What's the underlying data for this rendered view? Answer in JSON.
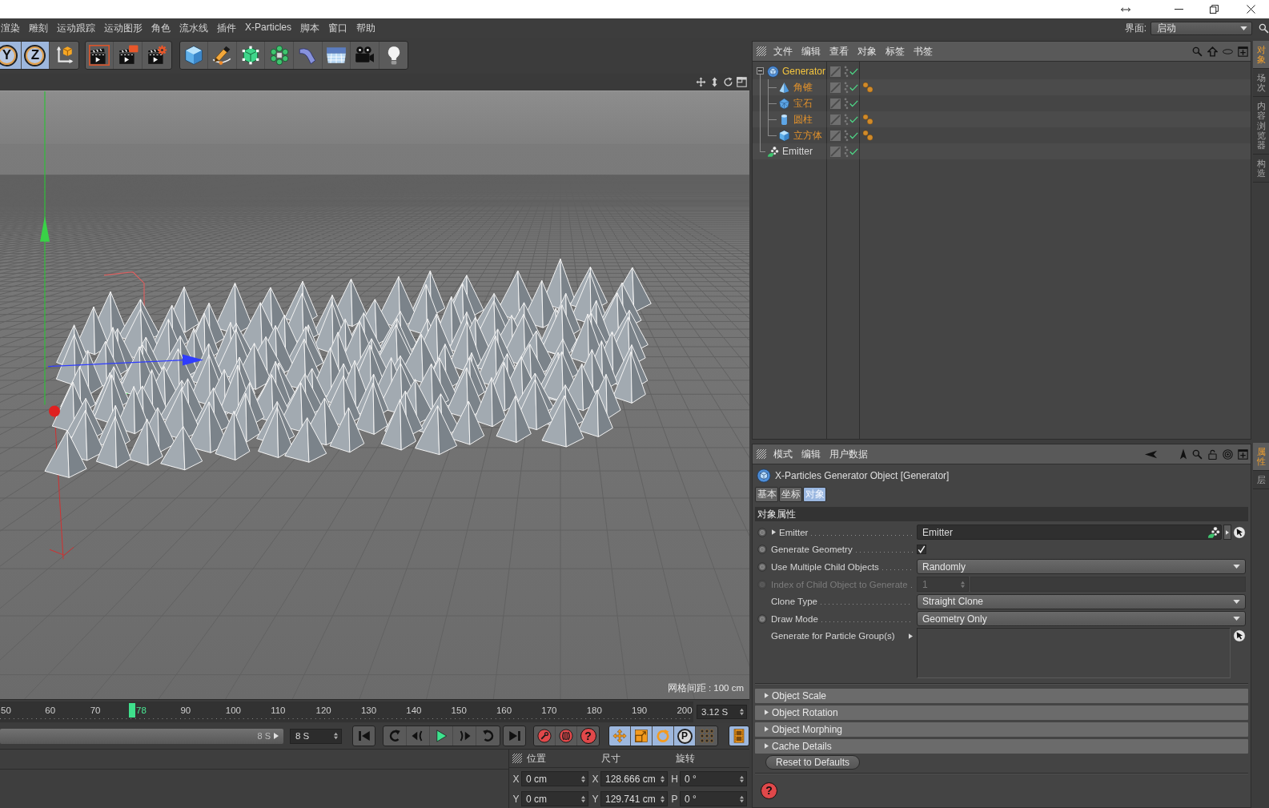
{
  "menu_bar": {
    "items": [
      "渲染",
      "雕刻",
      "运动跟踪",
      "运动图形",
      "角色",
      "流水线",
      "插件",
      "X-Particles",
      "脚本",
      "窗口",
      "帮助"
    ],
    "layout": {
      "label": "界面:",
      "value": "启动"
    }
  },
  "toolbar": {
    "groups": [
      {
        "buttons": [
          {
            "kind": "axis",
            "label": "Y",
            "selected": true
          },
          {
            "kind": "axis",
            "label": "Z",
            "selected": true
          },
          {
            "kind": "coordinate-system",
            "selected": false
          }
        ]
      },
      {
        "buttons": [
          {
            "kind": "render-view",
            "selected": false
          },
          {
            "kind": "render-picture-viewer",
            "selected": false
          },
          {
            "kind": "render-settings",
            "selected": false
          }
        ]
      },
      {
        "buttons": [
          {
            "kind": "cube",
            "selected": false
          },
          {
            "kind": "pen",
            "selected": false
          },
          {
            "kind": "subdivision",
            "selected": false
          },
          {
            "kind": "cloner",
            "selected": false
          },
          {
            "kind": "deformer",
            "selected": false
          },
          {
            "kind": "floor",
            "selected": false
          },
          {
            "kind": "camera",
            "selected": false
          },
          {
            "kind": "light",
            "selected": false
          }
        ]
      }
    ]
  },
  "viewport": {
    "grid_spacing": "网格间距 : 100 cm"
  },
  "timeline": {
    "marks": [
      {
        "kind": "tick",
        "label": "50"
      },
      {
        "kind": "tick",
        "label": "60"
      },
      {
        "kind": "tick",
        "label": "70"
      },
      {
        "kind": "playhead",
        "label": "78"
      },
      {
        "kind": "tick",
        "label": "90"
      },
      {
        "kind": "tick",
        "label": "100"
      },
      {
        "kind": "tick",
        "label": "110"
      },
      {
        "kind": "tick",
        "label": "120"
      },
      {
        "kind": "tick",
        "label": "130"
      },
      {
        "kind": "tick",
        "label": "140"
      },
      {
        "kind": "tick",
        "label": "150"
      },
      {
        "kind": "tick",
        "label": "160"
      },
      {
        "kind": "tick",
        "label": "170"
      },
      {
        "kind": "tick",
        "label": "180"
      },
      {
        "kind": "tick",
        "label": "190"
      },
      {
        "kind": "tick",
        "label": "200"
      }
    ],
    "current_time": "3.12 S"
  },
  "playback": {
    "range": {
      "label": "8 S",
      "level": 1
    },
    "end_time": "8 S",
    "groups": [
      {
        "buttons": [
          {
            "kind": "go-start",
            "selected": false
          }
        ]
      },
      {
        "buttons": [
          {
            "kind": "loop-back",
            "selected": false
          },
          {
            "kind": "step-back",
            "selected": false
          },
          {
            "kind": "play",
            "selected": false
          },
          {
            "kind": "step-forward",
            "selected": false
          },
          {
            "kind": "loop-forward",
            "selected": false
          }
        ]
      },
      {
        "buttons": [
          {
            "kind": "go-end",
            "selected": false
          }
        ]
      },
      {
        "buttons": [
          {
            "kind": "record",
            "selected": false
          },
          {
            "kind": "auto-key",
            "selected": false
          },
          {
            "kind": "key-help",
            "label": "?",
            "selected": false
          }
        ]
      },
      {
        "buttons": [
          {
            "kind": "move",
            "selected": true
          },
          {
            "kind": "scale",
            "selected": true
          },
          {
            "kind": "rotate",
            "selected": true
          },
          {
            "kind": "param",
            "label": "P",
            "selected": true
          },
          {
            "kind": "dots",
            "selected": false
          }
        ]
      },
      {
        "buttons": [
          {
            "kind": "film",
            "selected": true
          }
        ]
      }
    ]
  },
  "coordinates": {
    "headers": [
      "位置",
      "尺寸",
      "旋转"
    ],
    "rows": [
      [
        {
          "axis": "X",
          "value": "0 cm"
        },
        {
          "axis": "X",
          "value": "128.666 cm"
        },
        {
          "axis": "H",
          "value": "0 °"
        }
      ],
      [
        {
          "axis": "Y",
          "value": "0 cm"
        },
        {
          "axis": "Y",
          "value": "129.741 cm"
        },
        {
          "axis": "P",
          "value": "0 °"
        }
      ]
    ]
  },
  "object_manager": {
    "menu": [
      "文件",
      "编辑",
      "查看",
      "对象",
      "标签",
      "书签"
    ],
    "objects": [
      {
        "name": "Generator",
        "kind": "generator",
        "selected": true,
        "expanded": true,
        "enabled": true,
        "children": [
          {
            "name": "角锥",
            "kind": "pyramid",
            "selected": false,
            "highlighted": true,
            "enabled": true,
            "tags": [
              {
                "kind": "spheres"
              }
            ]
          },
          {
            "name": "宝石",
            "kind": "gem",
            "selected": false,
            "highlighted": true,
            "enabled": true
          },
          {
            "name": "圆柱",
            "kind": "cylinder",
            "selected": false,
            "highlighted": true,
            "enabled": true,
            "tags": [
              {
                "kind": "spheres"
              }
            ]
          },
          {
            "name": "立方体",
            "kind": "cube",
            "selected": false,
            "highlighted": true,
            "enabled": true,
            "tags": [
              {
                "kind": "spheres"
              }
            ]
          }
        ]
      },
      {
        "name": "Emitter",
        "kind": "emitter",
        "selected": false,
        "enabled": true
      }
    ]
  },
  "attribute_manager": {
    "menu": [
      "模式",
      "编辑",
      "用户数据"
    ],
    "object": {
      "kind": "generator",
      "title": "X-Particles Generator Object [Generator]"
    },
    "tabs": [
      {
        "label": "基本",
        "selected": false
      },
      {
        "label": "坐标",
        "selected": false
      },
      {
        "label": "对象",
        "selected": true
      }
    ],
    "section": "对象属性",
    "params": [
      {
        "kind": "link",
        "label": "Emitter",
        "animatable": true,
        "disabled": false,
        "target": {
          "kind": "emitter",
          "name": "Emitter"
        }
      },
      {
        "kind": "checkbox",
        "label": "Generate Geometry",
        "animatable": true,
        "disabled": false,
        "checked": true
      },
      {
        "kind": "dropdown",
        "label": "Use Multiple Child Objects",
        "animatable": true,
        "disabled": false,
        "value": "Randomly"
      },
      {
        "kind": "number",
        "label": "Index of Child Object to Generate",
        "animatable": true,
        "disabled": true,
        "value": "1"
      },
      {
        "kind": "dropdown",
        "label": "Clone Type",
        "animatable": false,
        "disabled": false,
        "value": "Straight Clone"
      },
      {
        "kind": "dropdown",
        "label": "Draw Mode",
        "animatable": true,
        "disabled": false,
        "value": "Geometry Only"
      },
      {
        "kind": "list",
        "label": "Generate for Particle Group(s)",
        "animatable": false,
        "disabled": false
      }
    ],
    "groups": [
      {
        "label": "Object Scale",
        "expanded": false
      },
      {
        "label": "Object Rotation",
        "expanded": false
      },
      {
        "label": "Object Morphing",
        "expanded": false
      },
      {
        "label": "Cache Details",
        "expanded": false
      }
    ],
    "reset_button": "Reset to Defaults",
    "help_button": "?"
  },
  "side_tabs": {
    "top": [
      {
        "label": "对象",
        "selected": true
      },
      {
        "label": "场次",
        "selected": false
      },
      {
        "label": "内容浏览器",
        "selected": false
      },
      {
        "label": "构造",
        "selected": false
      }
    ],
    "bottom": [
      {
        "label": "属性",
        "selected": true
      },
      {
        "label": "层",
        "selected": false
      }
    ]
  }
}
